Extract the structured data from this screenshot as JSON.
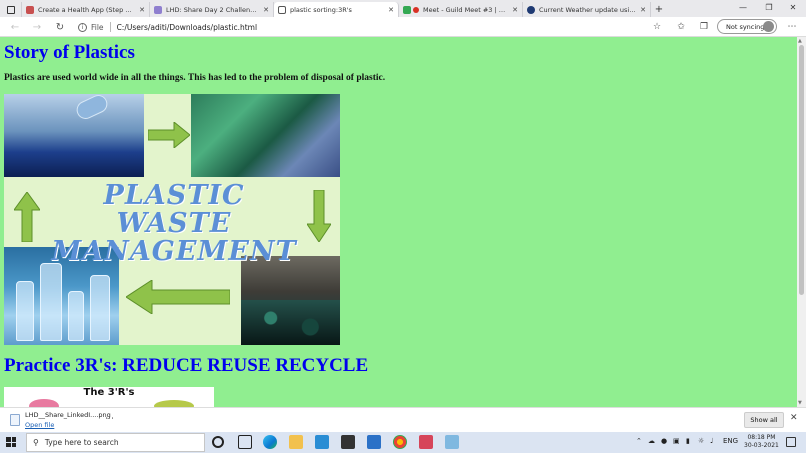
{
  "browser": {
    "tabs": [
      {
        "label": "Create a Health App (Step Cou",
        "active": false,
        "icon_color": "#c85050"
      },
      {
        "label": "LHD: Share Day 2 Challenges",
        "active": false,
        "icon_color": "#8f7fcf"
      },
      {
        "label": "plastic sorting:3R's",
        "active": true,
        "icon_color": "#555555"
      },
      {
        "label": "Meet - Guild Meet #3 | Skil",
        "active": false,
        "icon_color": "#34a853"
      },
      {
        "label": "Current Weather update using O",
        "active": false,
        "icon_color": "#1f3a73"
      }
    ],
    "address": {
      "scheme_label": "File",
      "url": "C:/Users/aditi/Downloads/plastic.html"
    },
    "sync_label": "Not syncing"
  },
  "page": {
    "heading": "Story of Plastics",
    "paragraph": "Plastics are used world wide in all the things. This has led to the problem of disposal of plastic.",
    "poster_title_line1": "PLASTIC WASTE",
    "poster_title_line2": "MANAGEMENT",
    "subheading": "Practice 3R's: REDUCE REUSE RECYCLE",
    "image2_title": "The 3'R's",
    "background_color": "#90ee90",
    "heading_color": "#0000ee"
  },
  "downloads": {
    "file_name": "LHD__Share_LinkedI....png",
    "open_label": "Open file",
    "show_all_label": "Show all"
  },
  "taskbar": {
    "search_placeholder": "Type here to search",
    "language": "ENG",
    "time": "08:18 PM",
    "date": "30-03-2021"
  }
}
